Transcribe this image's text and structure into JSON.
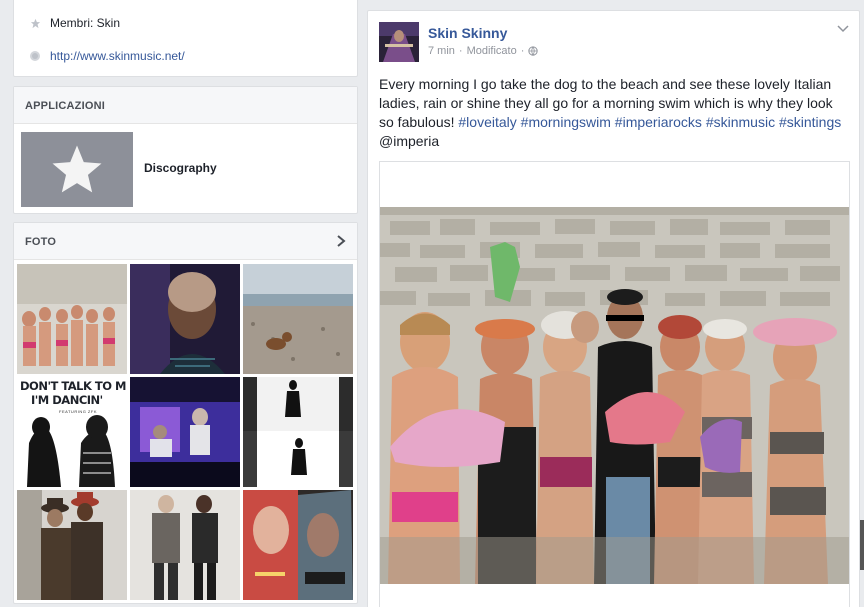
{
  "about": {
    "members": "Membri: Skin",
    "website": "http://www.skinmusic.net/"
  },
  "apps": {
    "header": "APPLICAZIONI",
    "items": [
      {
        "label": "Discography",
        "icon": "star-icon"
      }
    ]
  },
  "photos": {
    "header": "FOTO",
    "thumbs": [
      {
        "alt": "group-beach-photo"
      },
      {
        "alt": "skin-portrait"
      },
      {
        "alt": "beach-dog"
      },
      {
        "alt": "dont-talk-to-me-cover",
        "title_line1": "DON'T TALK TO ME",
        "title_line2": "I'M DANCIN'",
        "subtitle": "FEATURING ZFK"
      },
      {
        "alt": "stage-performance"
      },
      {
        "alt": "silhouette-video"
      },
      {
        "alt": "two-men-hats"
      },
      {
        "alt": "two-people-standing"
      },
      {
        "alt": "magazine-pages"
      }
    ]
  },
  "post": {
    "author": "Skin Skinny",
    "time": "7 min",
    "separator": "·",
    "edited": "Modificato",
    "sep2": "·",
    "privacy_icon": "globe-icon",
    "text_plain": "Every morning I go take the dog to the beach and see these lovely Italian ladies, rain or shine they all go for a morning swim which is why they look so fabulous!",
    "hashtags": [
      "#loveitaly",
      "#morningswim",
      "#imperiarocks",
      "#skinmusic",
      "#skintings"
    ],
    "mention": "@imperia"
  },
  "colors": {
    "link": "#365899",
    "bg": "#e9ebee"
  }
}
